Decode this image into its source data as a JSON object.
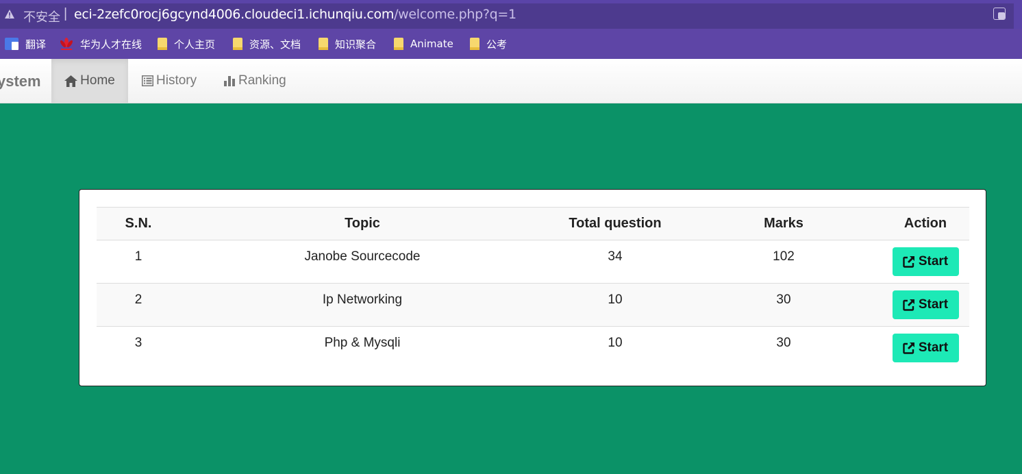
{
  "browser": {
    "security_label": "不安全",
    "separator": "|",
    "url_host": "eci-2zefc0rocj6gcynd4006.cloudeci1.ichunqiu.com",
    "url_path": "/welcome.php?q=1",
    "bookmarks": [
      {
        "label": "翻译",
        "icon": "google-translate-icon"
      },
      {
        "label": "华为人才在线",
        "icon": "huawei-icon"
      },
      {
        "label": "个人主页",
        "icon": "folder-icon"
      },
      {
        "label": "资源、文档",
        "icon": "folder-icon"
      },
      {
        "label": "知识聚合",
        "icon": "folder-icon"
      },
      {
        "label": "Animate",
        "icon": "folder-icon"
      },
      {
        "label": "公考",
        "icon": "folder-icon"
      }
    ]
  },
  "navbar": {
    "brand": "ystem",
    "items": [
      {
        "label": "Home",
        "icon": "home-icon",
        "active": true
      },
      {
        "label": "History",
        "icon": "list-icon",
        "active": false
      },
      {
        "label": "Ranking",
        "icon": "bar-chart-icon",
        "active": false
      }
    ]
  },
  "table": {
    "headers": [
      "S.N.",
      "Topic",
      "Total question",
      "Marks",
      "Action"
    ],
    "rows": [
      {
        "sn": "1",
        "topic": "Janobe Sourcecode",
        "total": "34",
        "marks": "102",
        "action": "Start"
      },
      {
        "sn": "2",
        "topic": "Ip Networking",
        "total": "10",
        "marks": "30",
        "action": "Start"
      },
      {
        "sn": "3",
        "topic": "Php & Mysqli",
        "total": "10",
        "marks": "30",
        "action": "Start"
      }
    ]
  },
  "colors": {
    "page_bg": "#0b9267",
    "button_bg": "#1de9b6",
    "address_bar": "#4d3a8e",
    "bookmarks_bar": "#5e45a6"
  }
}
